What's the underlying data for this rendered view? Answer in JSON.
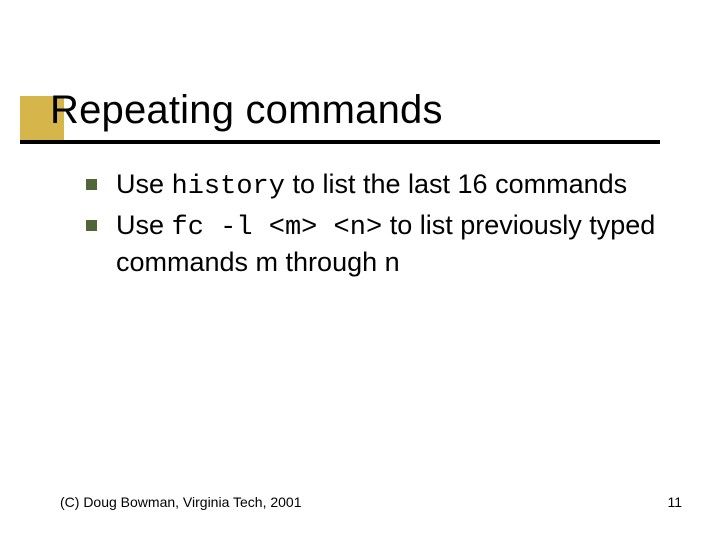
{
  "title": "Repeating commands",
  "bullets": [
    {
      "parts": [
        "Use ",
        "history",
        " to list the last 16 commands"
      ]
    },
    {
      "parts": [
        "Use ",
        "fc -l <m> <n>",
        " to list previously typed commands m through n"
      ]
    }
  ],
  "footer": {
    "copyright": "(C) Doug Bowman, Virginia Tech, 2001",
    "page": "11"
  },
  "colors": {
    "accent_gold": "#d6b54a",
    "bullet_green": "#4e6638",
    "underline": "#000000"
  }
}
